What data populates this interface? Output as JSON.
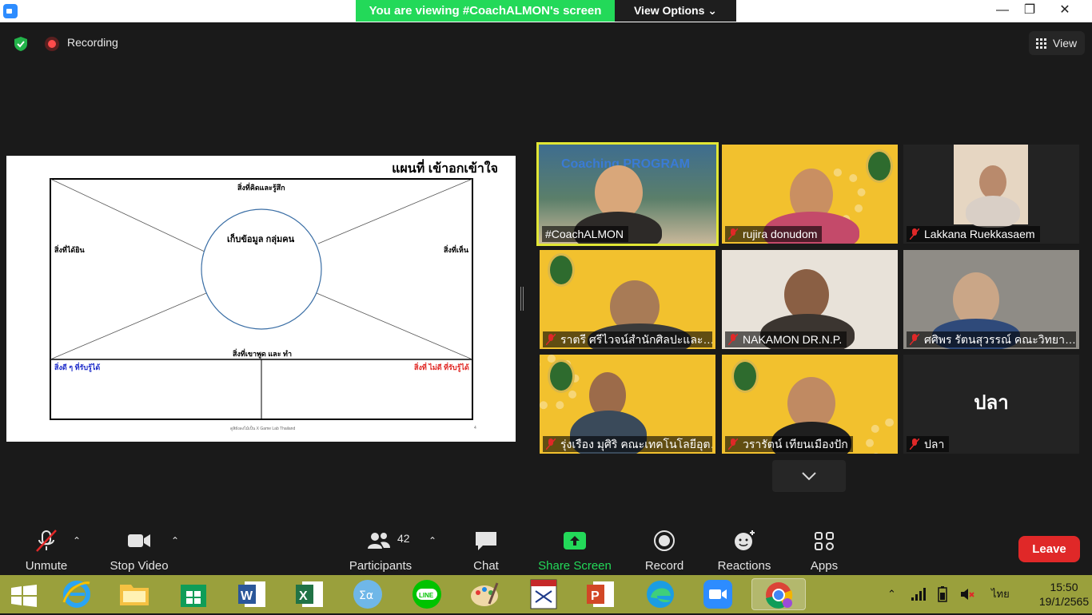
{
  "titlebar": {
    "viewing_banner": "You are viewing #CoachALMON's screen",
    "view_options": "View Options ⌄",
    "minimize": "—",
    "restore": "❐",
    "close": "✕"
  },
  "status": {
    "recording_label": "Recording",
    "view_label": "View"
  },
  "shared_screen": {
    "title": "แผนที่ เข้าอกเข้าใจ",
    "top_label": "สิ่งที่คิดและรู้สึก",
    "left_label": "สิ่งที่ได้ยิน",
    "right_label": "สิ่งที่เห็น",
    "center_label": "เก็บข้อมูล กลุ่มคน",
    "bottom_label": "สิ่งที่เขาพูด และ ทำ",
    "gain_label": "สิ่งดี ๆ ที่รับรู้ได้",
    "pain_label": "สิ่งที่ ไม่ดี ที่รับรู้ได้",
    "footer": "ดูสิยังลงไม้เป็น X Game Lab Thailand",
    "page": "4"
  },
  "participants": [
    {
      "name": "#CoachALMON",
      "muted": false,
      "overlay": "Coaching PROGRAM"
    },
    {
      "name": "rujira donudom",
      "muted": true
    },
    {
      "name": "Lakkana Ruekkasaem",
      "muted": true
    },
    {
      "name": "ราตรี   ศรีไวจน์สำนักศิลปะและ…",
      "muted": true
    },
    {
      "name": "NAKAMON DR.N.P.",
      "muted": true
    },
    {
      "name": "ศศิพร รัตนสุวรรณ์ คณะวิทยา…",
      "muted": true
    },
    {
      "name": "รุ่งเรือง มุศิริ คณะเทคโนโลยีอุต…",
      "muted": true
    },
    {
      "name": "วรารัตน์ เทียนเมืองปัก",
      "muted": true
    },
    {
      "name": "ปลา",
      "muted": true,
      "display_name": "ปลา"
    }
  ],
  "toolbar": {
    "unmute": "Unmute",
    "stop_video": "Stop Video",
    "participants": "Participants",
    "participants_count": "42",
    "chat": "Chat",
    "share_screen": "Share Screen",
    "record": "Record",
    "reactions": "Reactions",
    "apps": "Apps",
    "leave": "Leave"
  },
  "taskbar": {
    "language": "ไทย",
    "time": "15:50",
    "date": "19/1/2565"
  },
  "colors": {
    "banner_green": "#23d959",
    "leave_red": "#e02828",
    "active_speaker": "#e1e635",
    "taskbar": "#9aa03c"
  }
}
